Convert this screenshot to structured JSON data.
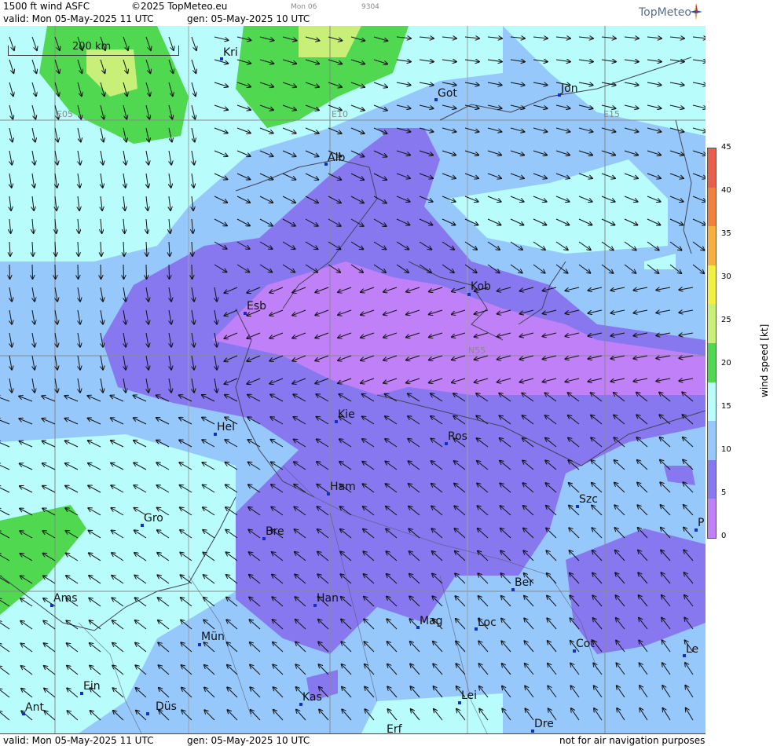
{
  "header": {
    "title": "1500 ft wind ASFC",
    "copyright": "©2025 TopMeteo.eu",
    "date_small": "Mon 06",
    "code_small": "9304",
    "valid": "valid:  Mon  05-May-2025  11 UTC",
    "gen": "gen: 05-May-2025 10 UTC",
    "logo": "TopMeteo"
  },
  "footer": {
    "valid": "valid:  Mon  05-May-2025  11 UTC",
    "gen": "gen: 05-May-2025 10 UTC",
    "disclaimer": "not for air navigation purposes"
  },
  "scale": {
    "label": "200 km"
  },
  "grid_labels": {
    "e05": "E05",
    "e10": "E10",
    "e15": "E15",
    "n55": "N55"
  },
  "legend": {
    "title": "wind speed [kt]",
    "ticks": [
      "45",
      "40",
      "35",
      "30",
      "25",
      "20",
      "15",
      "10",
      "5",
      "0"
    ],
    "colors": [
      "#e8604c",
      "#f0803c",
      "#f7b040",
      "#f0f040",
      "#c8f078",
      "#50d850",
      "#b8fcfc",
      "#96c8fc",
      "#8878f0",
      "#c080f8"
    ]
  },
  "cities": [
    {
      "name": "Kri"
    },
    {
      "name": "Got"
    },
    {
      "name": "Jon"
    },
    {
      "name": "Alb"
    },
    {
      "name": "Kob"
    },
    {
      "name": "Esb"
    },
    {
      "name": "Kie"
    },
    {
      "name": "Hel"
    },
    {
      "name": "Ros"
    },
    {
      "name": "Ham"
    },
    {
      "name": "Szc"
    },
    {
      "name": "Gro"
    },
    {
      "name": "Bre"
    },
    {
      "name": "P"
    },
    {
      "name": "Ber"
    },
    {
      "name": "Ams"
    },
    {
      "name": "Han"
    },
    {
      "name": "Mag"
    },
    {
      "name": "Loc"
    },
    {
      "name": "Mün"
    },
    {
      "name": "Cot"
    },
    {
      "name": "Le"
    },
    {
      "name": "Ein"
    },
    {
      "name": "Kas"
    },
    {
      "name": "Lei"
    },
    {
      "name": "Ant"
    },
    {
      "name": "Düs"
    },
    {
      "name": "Erf"
    },
    {
      "name": "Dre"
    }
  ]
}
